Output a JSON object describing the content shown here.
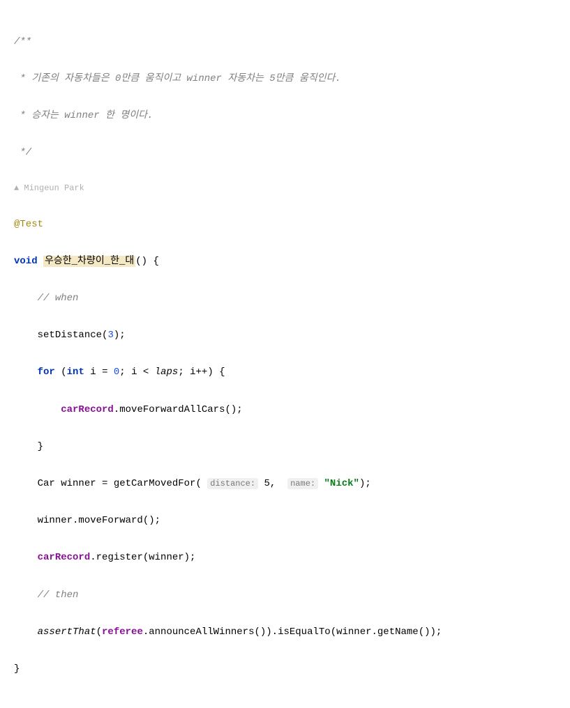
{
  "doc": {
    "open": "/**",
    "line1": " * 기존의 자동차들은 0만큼 움직이고 winner 자동차는 5만큼 움직인다.",
    "line2": " * 승자는 winner 한 명이다.",
    "close": " */"
  },
  "author": {
    "icon": "👤",
    "name": "Mingeun Park"
  },
  "annotation": "@Test",
  "signature": {
    "kw_void": "void",
    "method": "우승한_차량이_한_대",
    "parens": "() {"
  },
  "body": {
    "comment_when": "// when",
    "setDistance": "setDistance(",
    "setDistance_arg": "3",
    "setDistance_end": ");",
    "for_kw": "for",
    "for_open": " (",
    "int_kw": "int",
    "for_init": " i = ",
    "zero": "0",
    "for_cond": "; i < ",
    "laps": "laps",
    "for_inc": "; i++) {",
    "carRecord1": "carRecord",
    "moveForward": ".moveForwardAllCars();",
    "brace_close1": "}",
    "car_decl": "Car winner = getCarMovedFor(",
    "hint_distance": "distance:",
    "five": " 5",
    "comma": ", ",
    "hint_name": "name:",
    "space": " ",
    "nick": "\"Nick\"",
    "decl_end": ");",
    "winner_move": "winner.moveForward();",
    "carRecord2": "carRecord",
    "register": ".register(winner);",
    "comment_then": "// then",
    "assertThat": "assertThat",
    "assert_open": "(",
    "referee": "referee",
    "announce": ".announceAllWinners()).isEqualTo(winner.getName());"
  },
  "close_brace": "}"
}
